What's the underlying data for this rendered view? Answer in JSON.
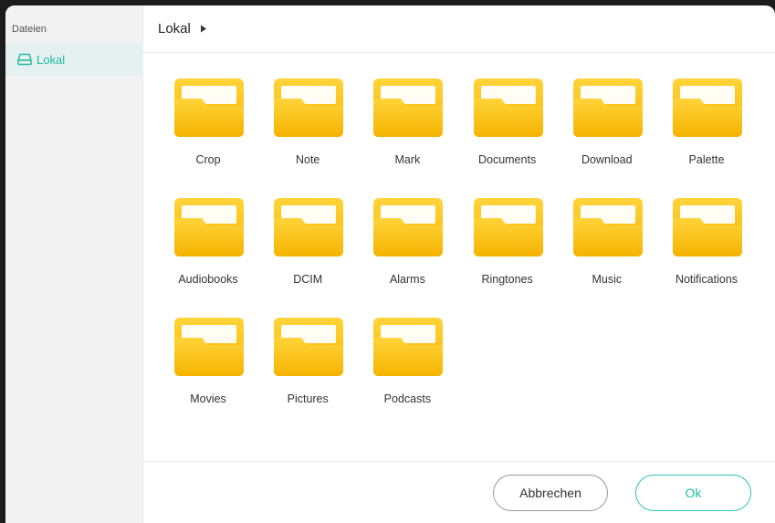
{
  "sidebar": {
    "title": "Dateien",
    "items": [
      {
        "label": "Lokal",
        "icon": "drive-icon",
        "active": true
      }
    ]
  },
  "header": {
    "breadcrumb": "Lokal",
    "arrow_icon": "triangle-right-icon"
  },
  "folders": [
    {
      "name": "Crop"
    },
    {
      "name": "Note"
    },
    {
      "name": "Mark"
    },
    {
      "name": "Documents"
    },
    {
      "name": "Download"
    },
    {
      "name": "Palette"
    },
    {
      "name": "Audiobooks"
    },
    {
      "name": "DCIM"
    },
    {
      "name": "Alarms"
    },
    {
      "name": "Ringtones"
    },
    {
      "name": "Music"
    },
    {
      "name": "Notifications"
    },
    {
      "name": "Movies"
    },
    {
      "name": "Pictures"
    },
    {
      "name": "Podcasts"
    }
  ],
  "footer": {
    "cancel_label": "Abbrechen",
    "ok_label": "Ok"
  },
  "colors": {
    "accent": "#20b8a2",
    "folder_top": "#ffd43a",
    "folder_bottom": "#f5b300"
  }
}
